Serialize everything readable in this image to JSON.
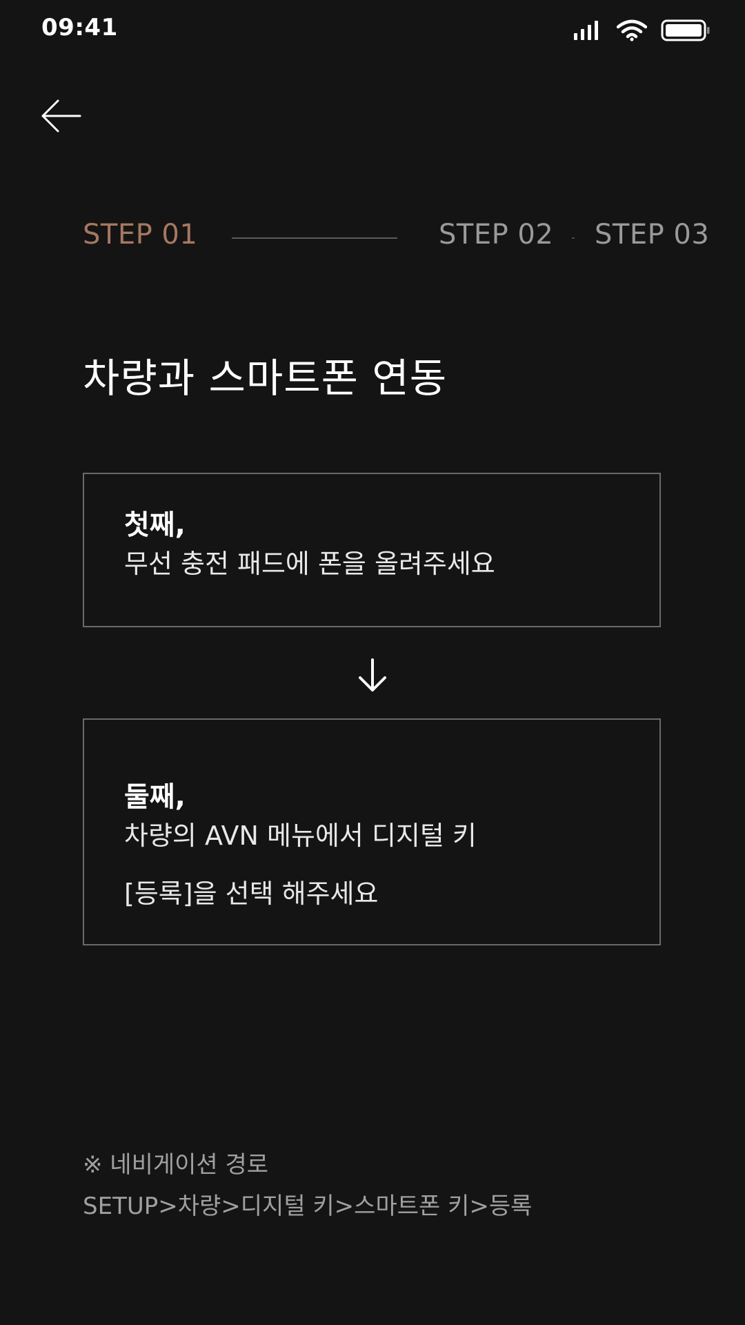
{
  "status_bar": {
    "time": "09:41",
    "icons": [
      "signal-icon",
      "wifi-icon",
      "battery-icon"
    ]
  },
  "header": {
    "back_icon": "back-arrow-icon"
  },
  "steps": [
    {
      "label": "STEP 01",
      "active": true
    },
    {
      "label": "STEP 02",
      "active": false
    },
    {
      "label": "STEP 03",
      "active": false
    }
  ],
  "title": "차량과 스마트폰 연동",
  "cards": [
    {
      "heading": "첫째,",
      "lines": [
        "무선 충전 패드에 폰을 올려주세요"
      ]
    },
    {
      "heading": "둘째,",
      "lines": [
        "차량의 AVN 메뉴에서 디지털 키",
        "[등록]을 선택 해주세요"
      ]
    }
  ],
  "connector_icon": "arrow-down-icon",
  "navigation_note": {
    "title": "※ 네비게이션 경로",
    "path": "SETUP>차량>디지털 키>스마트폰 키>등록"
  },
  "colors": {
    "background": "#141414",
    "active_step": "#a67861",
    "inactive_step": "#9a9a9a",
    "card_border": "#6a6a6a"
  }
}
